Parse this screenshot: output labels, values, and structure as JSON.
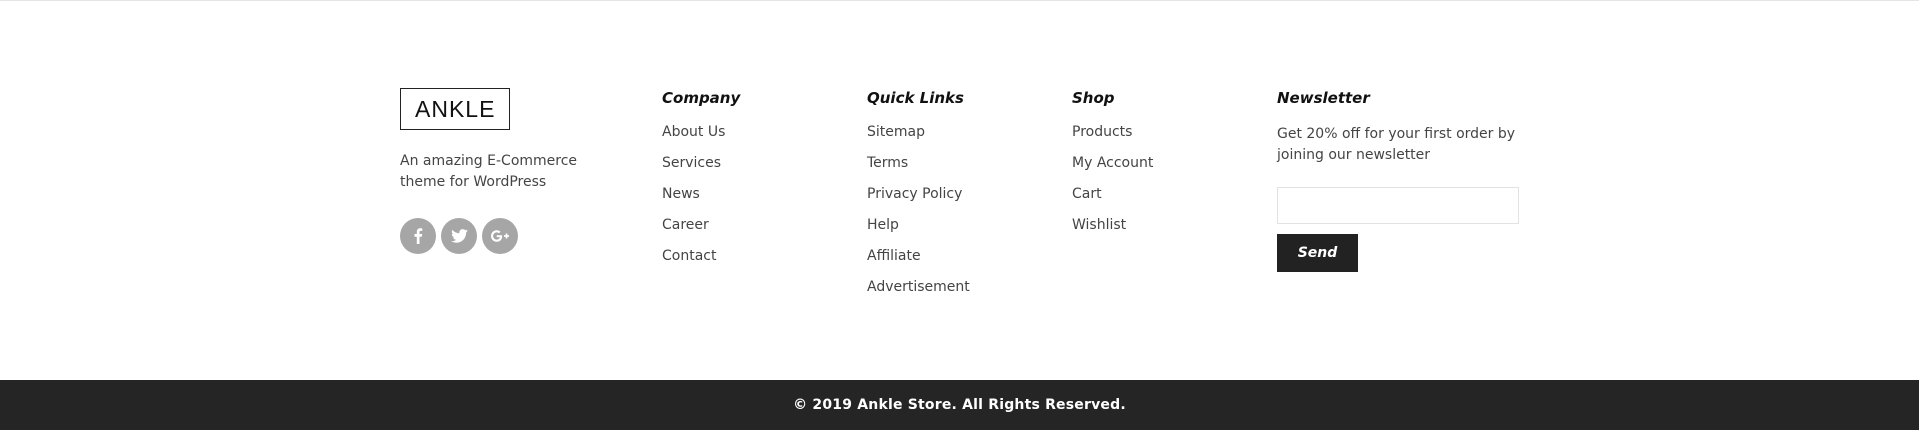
{
  "brand": {
    "logo_text": "ANKLE",
    "tagline": "An amazing E-Commerce theme for WordPress",
    "socials": [
      {
        "icon": "facebook-icon"
      },
      {
        "icon": "twitter-icon"
      },
      {
        "icon": "google-plus-icon"
      }
    ],
    "social_color": "#a6a6a6"
  },
  "company": {
    "title": "Company",
    "links": [
      "About Us",
      "Services",
      "News",
      "Career",
      "Contact"
    ]
  },
  "quick_links": {
    "title": "Quick Links",
    "links": [
      "Sitemap",
      "Terms",
      "Privacy Policy",
      "Help",
      "Affiliate",
      "Advertisement"
    ]
  },
  "shop": {
    "title": "Shop",
    "links": [
      "Products",
      "My Account",
      "Cart",
      "Wishlist"
    ]
  },
  "newsletter": {
    "title": "Newsletter",
    "text": "Get 20% off for your first order by joining our newsletter",
    "email_value": "",
    "send_label": "Send"
  },
  "footer_bar": {
    "copyright": "© 2019 Ankle Store. All Rights Reserved.",
    "background": "#252525"
  }
}
